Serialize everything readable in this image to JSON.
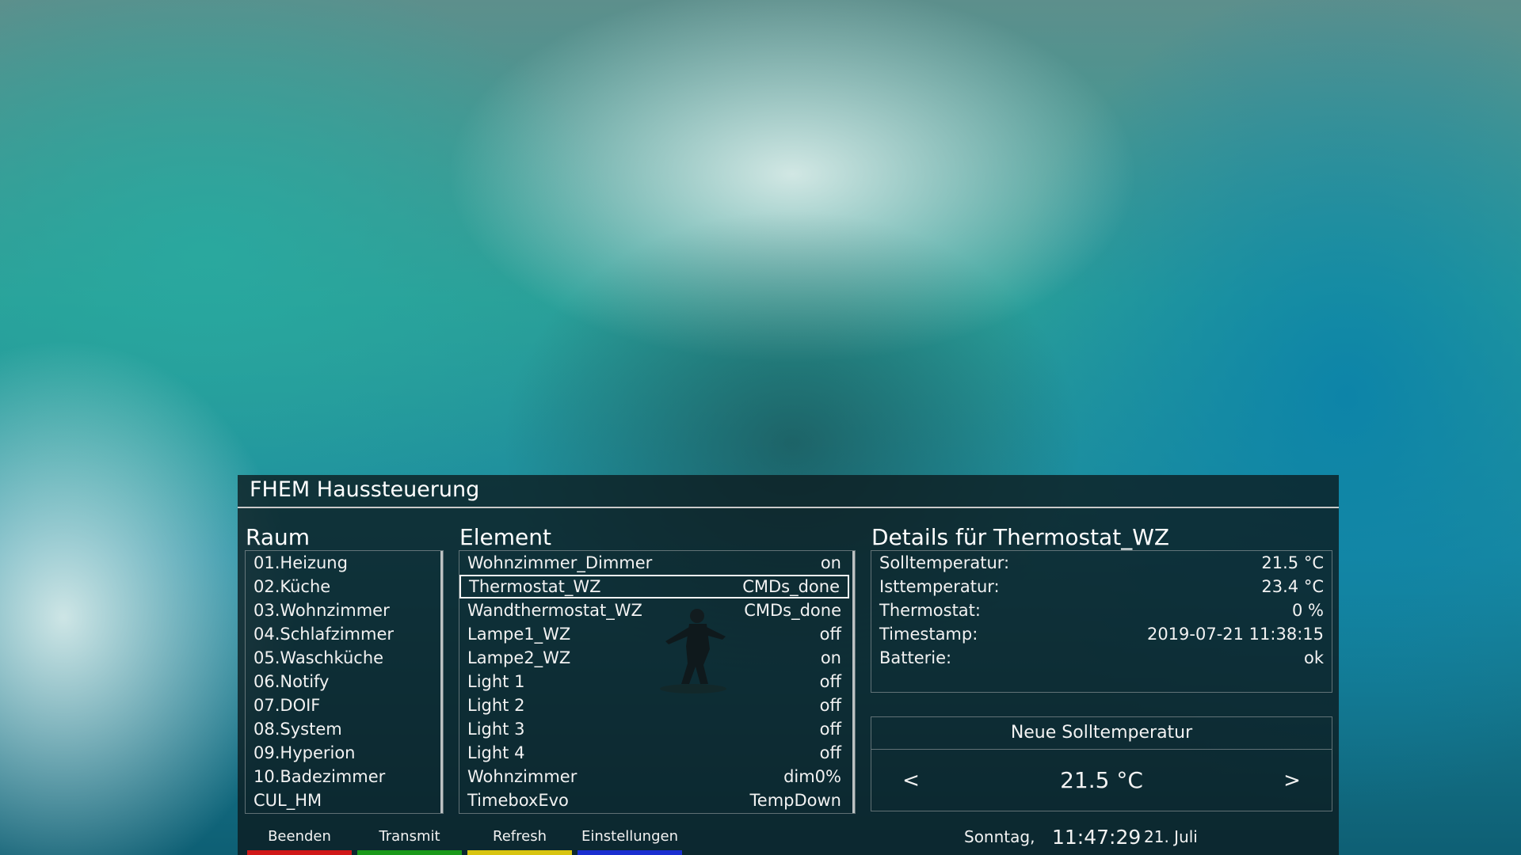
{
  "panel": {
    "title": "FHEM Haussteuerung"
  },
  "room": {
    "heading": "Raum",
    "items": [
      {
        "label": "01.Heizung"
      },
      {
        "label": "02.Küche"
      },
      {
        "label": "03.Wohnzimmer"
      },
      {
        "label": "04.Schlafzimmer"
      },
      {
        "label": "05.Waschküche"
      },
      {
        "label": "06.Notify"
      },
      {
        "label": "07.DOIF"
      },
      {
        "label": "08.System"
      },
      {
        "label": "09.Hyperion"
      },
      {
        "label": "10.Badezimmer"
      },
      {
        "label": "CUL_HM"
      }
    ]
  },
  "element": {
    "heading": "Element",
    "selected_index": 1,
    "items": [
      {
        "name": "Wohnzimmer_Dimmer",
        "state": "on"
      },
      {
        "name": "Thermostat_WZ",
        "state": "CMDs_done"
      },
      {
        "name": "Wandthermostat_WZ",
        "state": "CMDs_done"
      },
      {
        "name": "Lampe1_WZ",
        "state": "off"
      },
      {
        "name": "Lampe2_WZ",
        "state": "on"
      },
      {
        "name": "Light 1",
        "state": "off"
      },
      {
        "name": "Light 2",
        "state": "off"
      },
      {
        "name": "Light 3",
        "state": "off"
      },
      {
        "name": "Light 4",
        "state": "off"
      },
      {
        "name": "Wohnzimmer",
        "state": "dim0%"
      },
      {
        "name": "TimeboxEvo",
        "state": "TempDown"
      }
    ]
  },
  "details": {
    "heading": "Details für Thermostat_WZ",
    "rows": [
      {
        "label": "Solltemperatur:",
        "value": "21.5 °C"
      },
      {
        "label": "Isttemperatur:",
        "value": "23.4 °C"
      },
      {
        "label": "Thermostat:",
        "value": "0 %"
      },
      {
        "label": "Timestamp:",
        "value": "2019-07-21 11:38:15"
      },
      {
        "label": "Batterie:",
        "value": "ok"
      }
    ]
  },
  "new_temp": {
    "title": "Neue Solltemperatur",
    "value": "21.5 °C",
    "prev_label": "<",
    "next_label": ">"
  },
  "footer": {
    "buttons": [
      {
        "label": "Beenden",
        "color": "#d01818"
      },
      {
        "label": "Transmit",
        "color": "#1a9a1a"
      },
      {
        "label": "Refresh",
        "color": "#d8c410"
      },
      {
        "label": "Einstellungen",
        "color": "#1a2fd0"
      }
    ],
    "day": "Sonntag,",
    "time": "11:47:29",
    "date": "21. Juli"
  }
}
